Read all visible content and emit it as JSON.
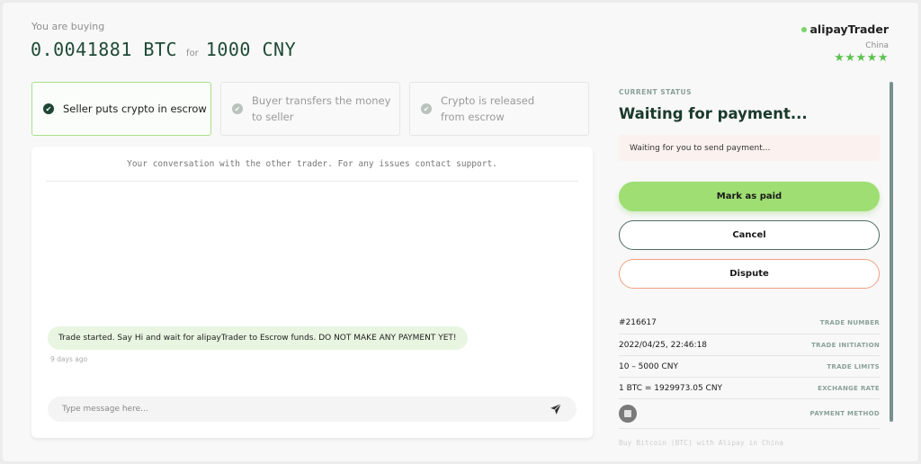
{
  "header": {
    "buying_label": "You are buying",
    "crypto_amount": "0.0041881 BTC",
    "for_label": "for",
    "fiat_amount": "1000 CNY"
  },
  "trader": {
    "name": "alipayTrader",
    "status": "online",
    "country": "China",
    "rating_stars": 5,
    "stars_display": "★★★★★"
  },
  "steps": [
    {
      "label": "Seller puts crypto in escrow",
      "state": "complete",
      "icon": "check-circle-icon"
    },
    {
      "label": "Buyer transfers the money to seller",
      "state": "pending",
      "icon": "check-circle-icon"
    },
    {
      "label": "Crypto is released from escrow",
      "state": "pending",
      "icon": "check-circle-icon"
    }
  ],
  "chat": {
    "intro": "Your conversation with the other trader. For any issues contact support.",
    "messages": [
      {
        "text": "Trade started. Say Hi and wait for alipayTrader to Escrow funds. DO NOT MAKE ANY PAYMENT YET!",
        "time": "9 days ago"
      }
    ],
    "input_placeholder": "Type message here...",
    "input_value": "",
    "send_icon": "send-icon"
  },
  "status": {
    "kicker": "CURRENT STATUS",
    "title": "Waiting for payment...",
    "note": "Waiting for you to send payment...",
    "buttons": {
      "mark_paid": "Mark as paid",
      "cancel": "Cancel",
      "dispute": "Dispute"
    },
    "details": [
      {
        "value": "#216617",
        "label": "TRADE NUMBER"
      },
      {
        "value": "2022/04/25, 22:46:18",
        "label": "TRADE INITIATION"
      },
      {
        "value": "10 – 5000 CNY",
        "label": "TRADE LIMITS"
      },
      {
        "value": "1 BTC = 1929973.05 CNY",
        "label": "EXCHANGE RATE"
      }
    ],
    "payment_method_label": "PAYMENT METHOD",
    "payment_method_icon": "alipay-icon",
    "payment_description": "Buy Bitcoin (BTC) with Alipay in China"
  },
  "colors": {
    "brand_green": "#1f4a37",
    "accent_green": "#9ede72",
    "star_green": "#5cc24e",
    "dispute_orange": "#f1a182",
    "note_bg": "#fbf1ee"
  }
}
